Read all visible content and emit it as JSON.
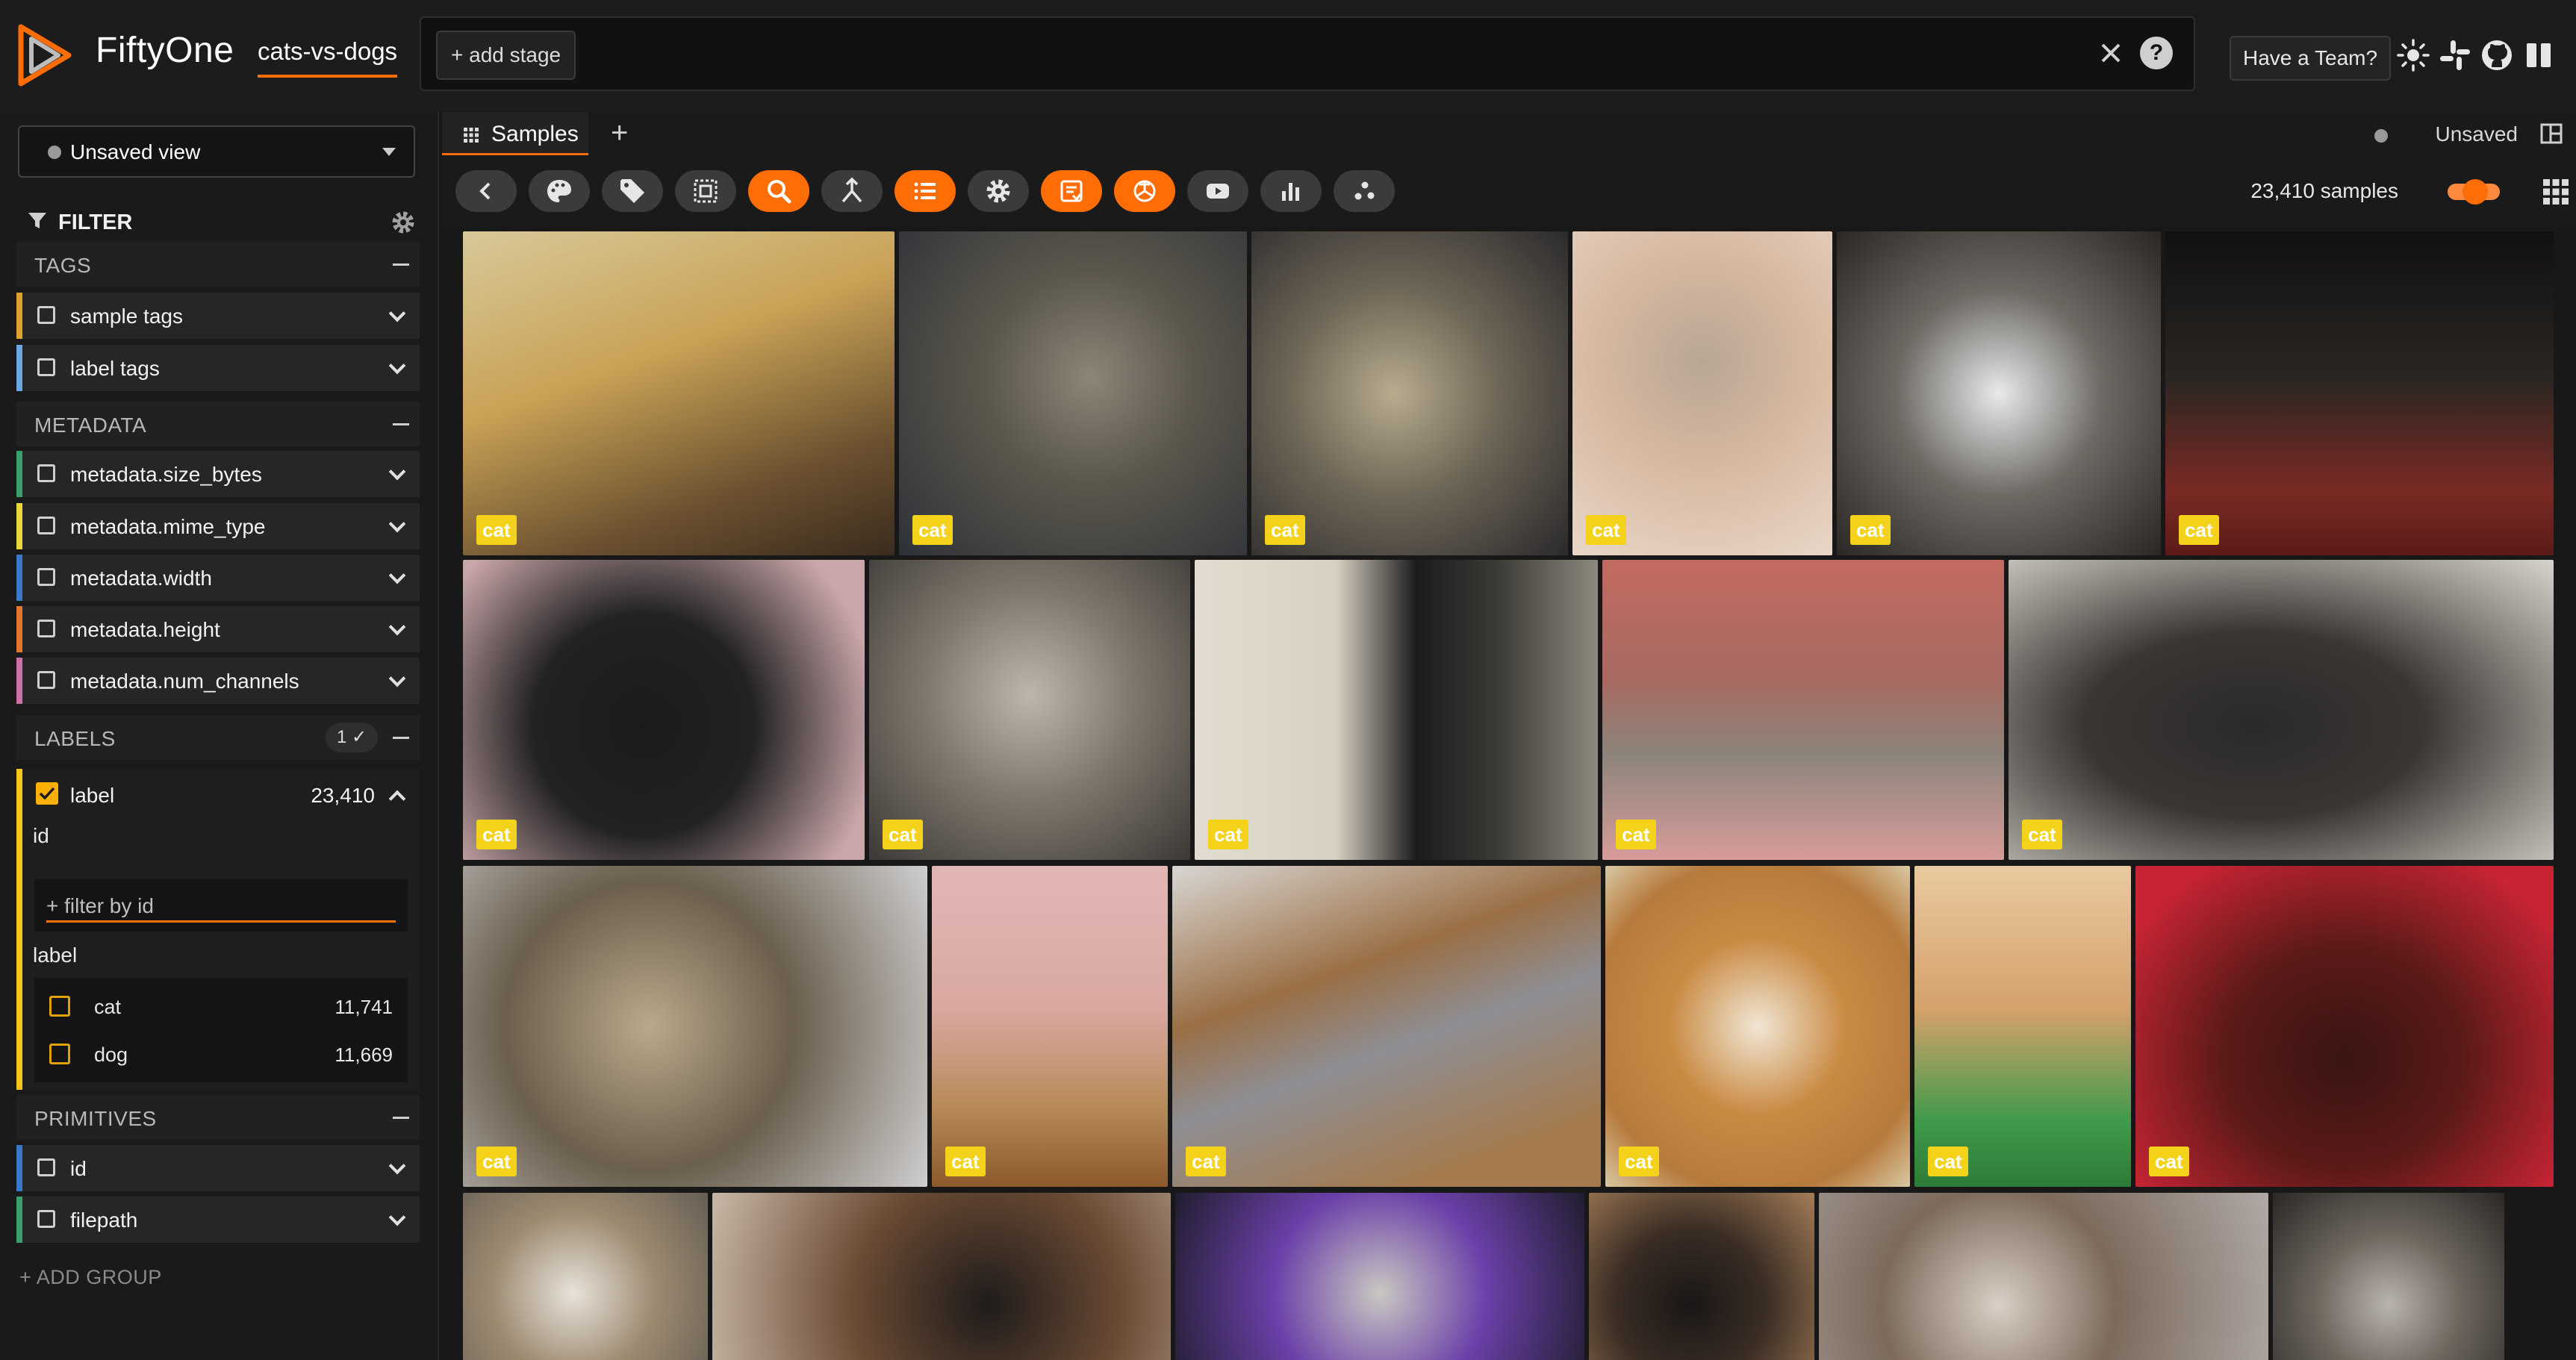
{
  "app": {
    "title": "FiftyOne",
    "dataset": "cats-vs-dogs"
  },
  "header": {
    "add_stage": "+ add stage",
    "help": "?",
    "team_button": "Have a Team?"
  },
  "sidebar": {
    "view_select": "Unsaved view",
    "filter_title": "FILTER",
    "groups": {
      "tags": "TAGS",
      "metadata": "METADATA",
      "labels": "LABELS",
      "primitives": "PRIMITIVES"
    },
    "tags": [
      "sample tags",
      "label tags"
    ],
    "metadata": [
      "metadata.size_bytes",
      "metadata.mime_type",
      "metadata.width",
      "metadata.height",
      "metadata.num_channels"
    ],
    "labels_badge": "1 ✓",
    "label_field": {
      "name": "label",
      "count": "23,410",
      "id_label": "id",
      "id_placeholder": "+ filter by id",
      "label_label": "label",
      "values": [
        {
          "name": "cat",
          "count": "11,741"
        },
        {
          "name": "dog",
          "count": "11,669"
        }
      ]
    },
    "primitives": [
      "id",
      "filepath"
    ],
    "add_group": "+ ADD GROUP"
  },
  "main": {
    "tab": "Samples",
    "tab_add": "+",
    "unsaved": "Unsaved",
    "samples_count": "23,410 samples"
  },
  "gallery": {
    "tag": "cat"
  },
  "colors": {
    "accent": "#ff6d04",
    "tag": "#f5d21a",
    "bg": "#181818"
  }
}
